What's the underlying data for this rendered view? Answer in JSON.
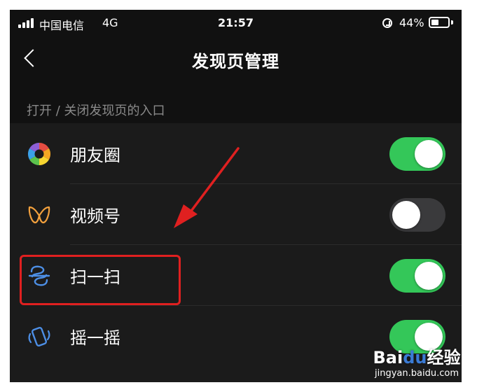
{
  "status_bar": {
    "carrier": "中国电信",
    "network": "4G",
    "time": "21:57",
    "battery": "44%",
    "battery_level": 0.44
  },
  "nav": {
    "title": "发现页管理"
  },
  "section_header": "打开 / 关闭发现页的入口",
  "items": [
    {
      "label": "朋友圈",
      "icon": "moments-icon",
      "enabled": true
    },
    {
      "label": "视频号",
      "icon": "channels-icon",
      "enabled": false
    },
    {
      "label": "扫一扫",
      "icon": "scan-icon",
      "enabled": true
    },
    {
      "label": "摇一摇",
      "icon": "shake-icon",
      "enabled": true
    }
  ],
  "colors": {
    "toggle_on": "#34c759",
    "toggle_off": "#3a3a3c",
    "annotation": "#e02020"
  },
  "watermark": {
    "brand_a": "Bai",
    "brand_b": "du",
    "brand_c": "经验",
    "url": "jingyan.baidu.com"
  }
}
